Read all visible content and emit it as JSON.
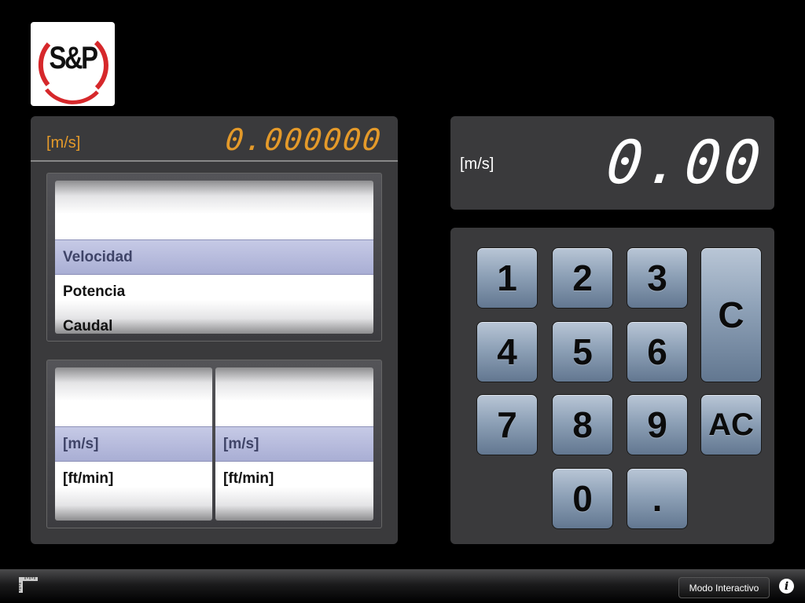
{
  "logo": {
    "text": "S&P",
    "icon": "sp-brand-logo",
    "colors": {
      "ring": "#d6282b",
      "text": "#111111"
    }
  },
  "converter": {
    "result_unit": "[m/s]",
    "result_value": "0.000000",
    "magnitude_options": [
      "Velocidad",
      "Potencia",
      "Caudal"
    ],
    "magnitude_selected": "Velocidad",
    "from_units": [
      "[m/s]",
      "[ft/min]"
    ],
    "to_units": [
      "[m/s]",
      "[ft/min]"
    ],
    "from_selected": "[m/s]",
    "to_selected": "[m/s]"
  },
  "display": {
    "unit": "[m/s]",
    "value": "0.00"
  },
  "keypad": {
    "keys": [
      "1",
      "2",
      "3",
      "4",
      "5",
      "6",
      "7",
      "8",
      "9",
      "0",
      "."
    ],
    "clear": "C",
    "all_clear": "AC"
  },
  "toolbar": {
    "ruler_icon": "ruler-icon",
    "mode_button": "Modo Interactivo",
    "info_icon": "i"
  },
  "colors": {
    "accent_orange": "#e49a2a",
    "selection_band": "#b4b9dc",
    "key_blue": "#8ea1b7"
  }
}
